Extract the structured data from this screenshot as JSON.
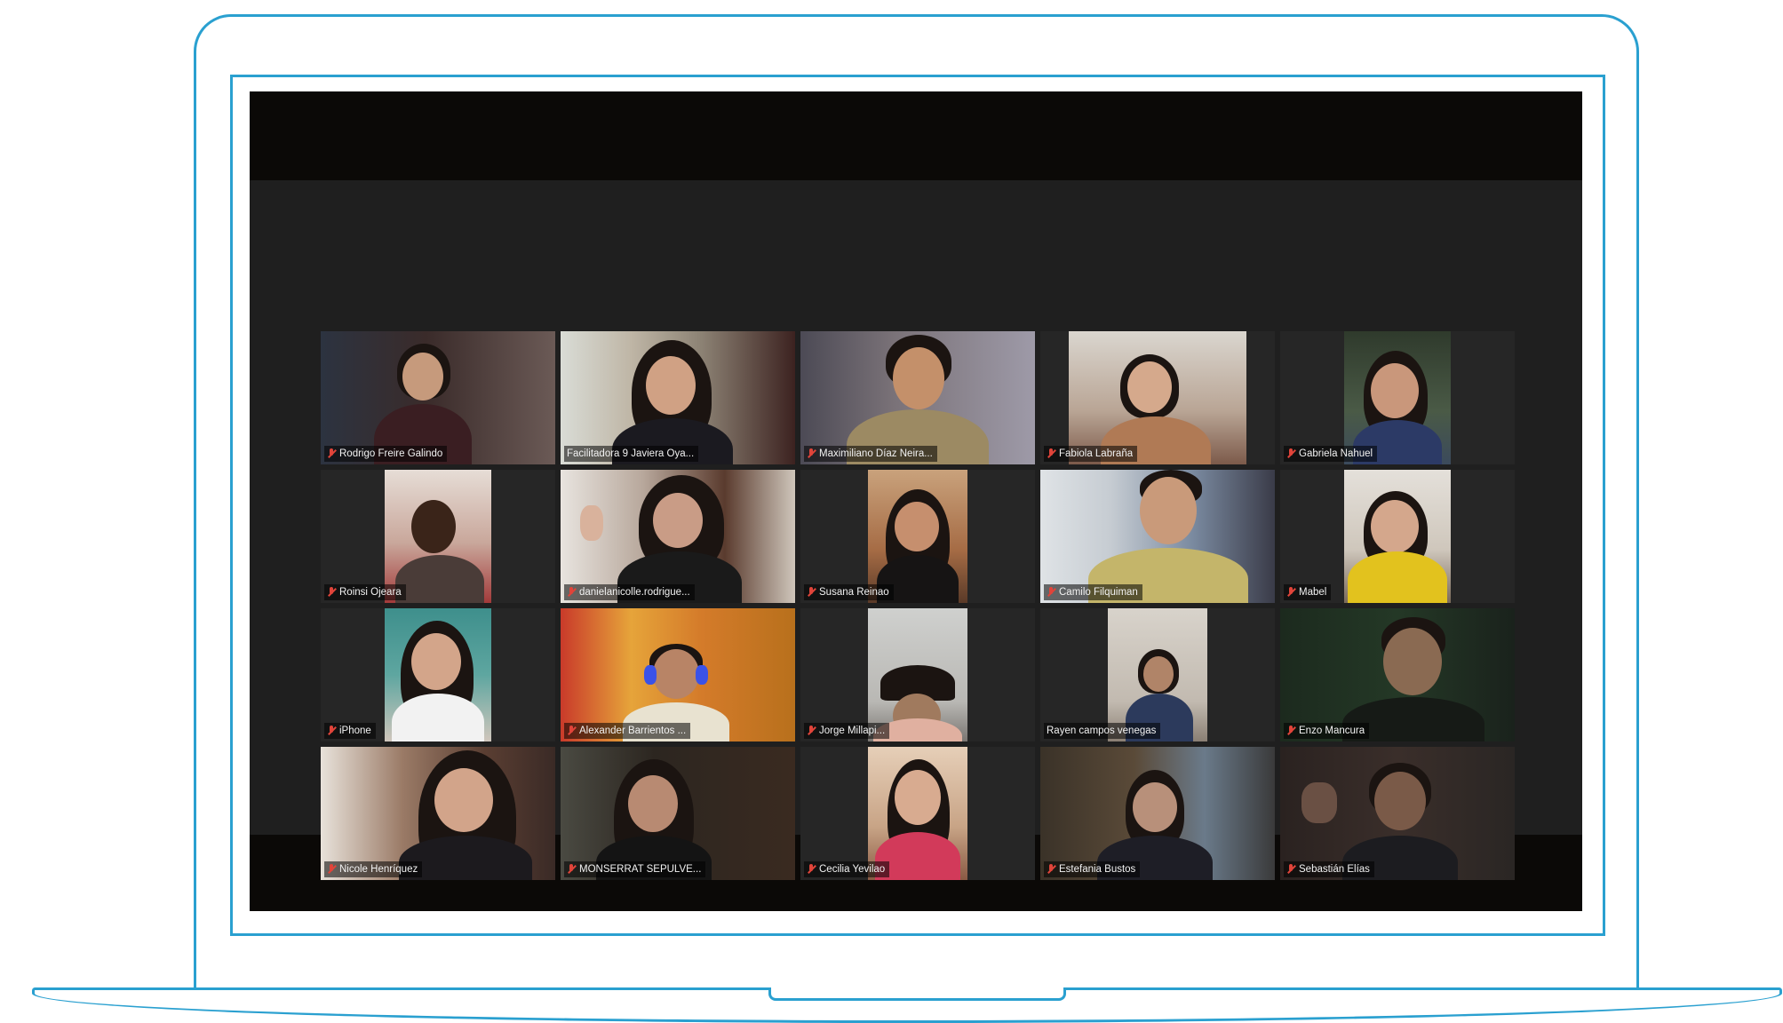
{
  "accent": "#2aa0d0",
  "participants": [
    {
      "name": "Rodrigo Freire Galindo",
      "muted": true
    },
    {
      "name": "Facilitadora 9 Javiera Oya...",
      "muted": false,
      "active": true
    },
    {
      "name": "Maximiliano Díaz Neira...",
      "muted": true
    },
    {
      "name": "Fabiola Labraña",
      "muted": true
    },
    {
      "name": "Gabriela Nahuel",
      "muted": true
    },
    {
      "name": "Roinsi Ojeara",
      "muted": true
    },
    {
      "name": "danielanicolle.rodrigue...",
      "muted": true
    },
    {
      "name": "Susana Reinao",
      "muted": true
    },
    {
      "name": "Camilo Filquiman",
      "muted": true
    },
    {
      "name": "Mabel",
      "muted": true
    },
    {
      "name": "iPhone",
      "muted": true
    },
    {
      "name": "Alexander Barrientos ...",
      "muted": true
    },
    {
      "name": "Jorge Millapi...",
      "muted": true
    },
    {
      "name": "Rayen campos venegas",
      "muted": false
    },
    {
      "name": "Enzo Mancura",
      "muted": true
    },
    {
      "name": "Nicole Henríquez",
      "muted": true
    },
    {
      "name": "MONSERRAT SEPULVE...",
      "muted": true
    },
    {
      "name": "Cecilia Yevilao",
      "muted": true
    },
    {
      "name": "Estefania Bustos",
      "muted": true
    },
    {
      "name": "Sebastián Elías",
      "muted": true
    }
  ]
}
